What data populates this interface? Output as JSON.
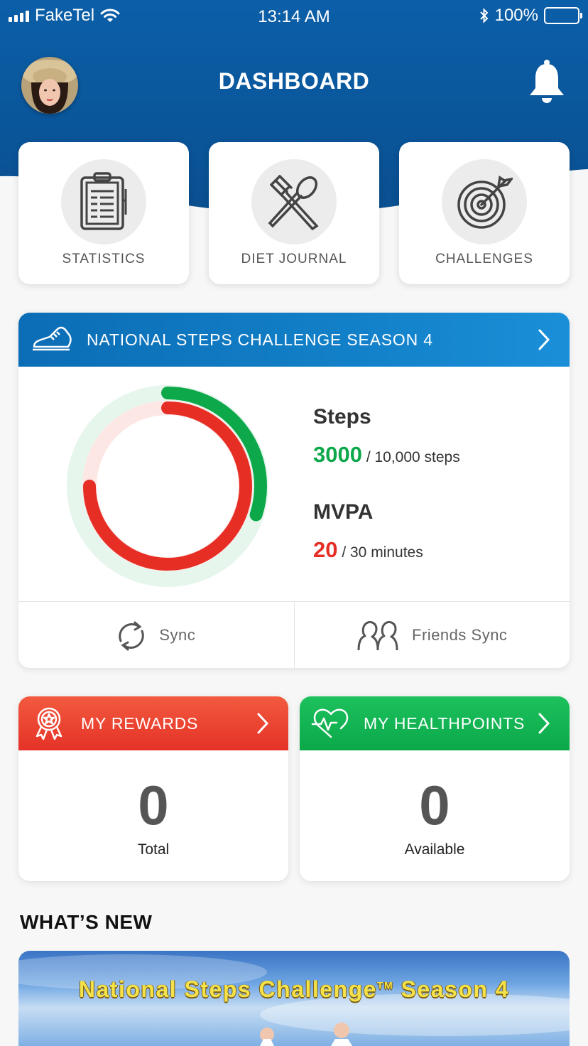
{
  "status_bar": {
    "carrier": "FakeTel",
    "time": "13:14 AM",
    "battery": "100%"
  },
  "header": {
    "title": "DASHBOARD"
  },
  "tiles": [
    {
      "label": "STATISTICS",
      "icon": "clipboard-icon"
    },
    {
      "label": "DIET JOURNAL",
      "icon": "fork-spoon-icon"
    },
    {
      "label": "CHALLENGES",
      "icon": "target-icon"
    }
  ],
  "challenge": {
    "title": "NATIONAL STEPS CHALLENGE SEASON 4",
    "steps_label": "Steps",
    "steps_value": "3000",
    "steps_goal": "/ 10,000 steps",
    "mvpa_label": "MVPA",
    "mvpa_value": "20",
    "mvpa_goal": "/ 30 minutes",
    "ring_outer_progress": 0.3,
    "ring_inner_progress": 0.75,
    "outer_color": "#0da84a",
    "inner_color": "#e62e25",
    "sync_label": "Sync",
    "friends_sync_label": "Friends Sync"
  },
  "rewards": {
    "title": "MY REWARDS",
    "value": "0",
    "caption": "Total",
    "color": "#e53228"
  },
  "healthpoints": {
    "title": "MY HEALTHPOINTS",
    "value": "0",
    "caption": "Available",
    "color": "#0ba84a"
  },
  "whats_new": {
    "heading": "WHAT’S NEW",
    "banner_title": "National Steps Challenge",
    "banner_tm": "TM",
    "banner_season": "Season 4"
  }
}
